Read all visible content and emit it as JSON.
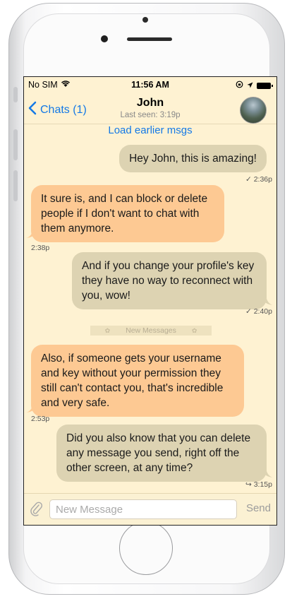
{
  "statusbar": {
    "carrier": "No SIM",
    "time": "11:56 AM"
  },
  "navbar": {
    "back_label": "Chats (1)",
    "title": "John",
    "subtitle": "Last seen:  3:19p"
  },
  "chat": {
    "load_earlier": "Load earlier msgs",
    "new_messages_label": "New Messages",
    "messages": [
      {
        "direction": "out",
        "text": "Hey John, this is amazing!",
        "time": "✓ 2:36p"
      },
      {
        "direction": "in",
        "text": "It sure is, and I can block or delete people if I don't want to chat with them anymore.",
        "time": "2:38p"
      },
      {
        "direction": "out",
        "text": "And if you change your profile's key they have no way to reconnect with you, wow!",
        "time": "✓ 2:40p"
      },
      {
        "direction": "in",
        "text": "Also, if someone gets your username and key without your permission they still can't contact you, that's incredible and very safe.",
        "time": "2:53p"
      },
      {
        "direction": "out",
        "text": "Did you also know that you can delete any message you send, right off the other screen, at any time?",
        "time": "↪ 3:15p"
      }
    ]
  },
  "composer": {
    "placeholder": "New Message",
    "send_label": "Send"
  },
  "colors": {
    "accent": "#1479e6",
    "outgoing_bubble": "#ddd3b2",
    "incoming_bubble": "#fdc993",
    "screen_background": "#fef2d2"
  }
}
